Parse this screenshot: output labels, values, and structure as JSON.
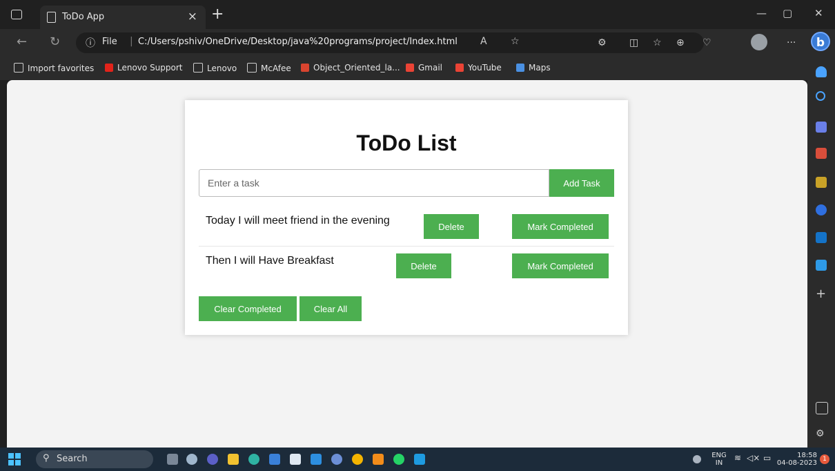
{
  "browser": {
    "tab_title": "ToDo App",
    "tab_close": "×",
    "new_tab": "+",
    "file_label": "File",
    "url": "C:/Users/pshiv/OneDrive/Desktop/java%20programs/project/Index.html",
    "bing_label": "b",
    "menu_more": "···",
    "window_controls": {
      "minimize": "—",
      "maximize": "▢",
      "close": "✕"
    }
  },
  "favorites": [
    {
      "label": "Import favorites",
      "icon": "import-icon",
      "color": "#cfcfcf"
    },
    {
      "label": "Lenovo Support",
      "icon": "lenovo-icon",
      "color": "#e2231a"
    },
    {
      "label": "Lenovo",
      "icon": "page-icon",
      "color": "#cfcfcf"
    },
    {
      "label": "McAfee",
      "icon": "page-icon",
      "color": "#cfcfcf"
    },
    {
      "label": "Object_Oriented_la...",
      "icon": "pdf-icon",
      "color": "#d9442f"
    },
    {
      "label": "Gmail",
      "icon": "gmail-icon",
      "color": "#ea4335"
    },
    {
      "label": "YouTube",
      "icon": "gmail-icon",
      "color": "#ea4335"
    },
    {
      "label": "Maps",
      "icon": "maps-icon",
      "color": "#4a90e2"
    }
  ],
  "app": {
    "title": "ToDo List",
    "input_placeholder": "Enter a task",
    "add_button": "Add Task",
    "tasks": [
      {
        "text": "Today I will meet friend in the evening",
        "delete_label": "Delete",
        "complete_label": "Mark Completed"
      },
      {
        "text": "Then I will Have Breakfast",
        "delete_label": "Delete",
        "complete_label": "Mark Completed"
      }
    ],
    "clear_completed": "Clear Completed",
    "clear_all": "Clear All",
    "accent_color": "#4caf50"
  },
  "taskbar": {
    "search_label": "Search",
    "lang_top": "ENG",
    "lang_bottom": "IN",
    "time": "18:58",
    "date": "04-08-2023",
    "notification_count": "1"
  }
}
